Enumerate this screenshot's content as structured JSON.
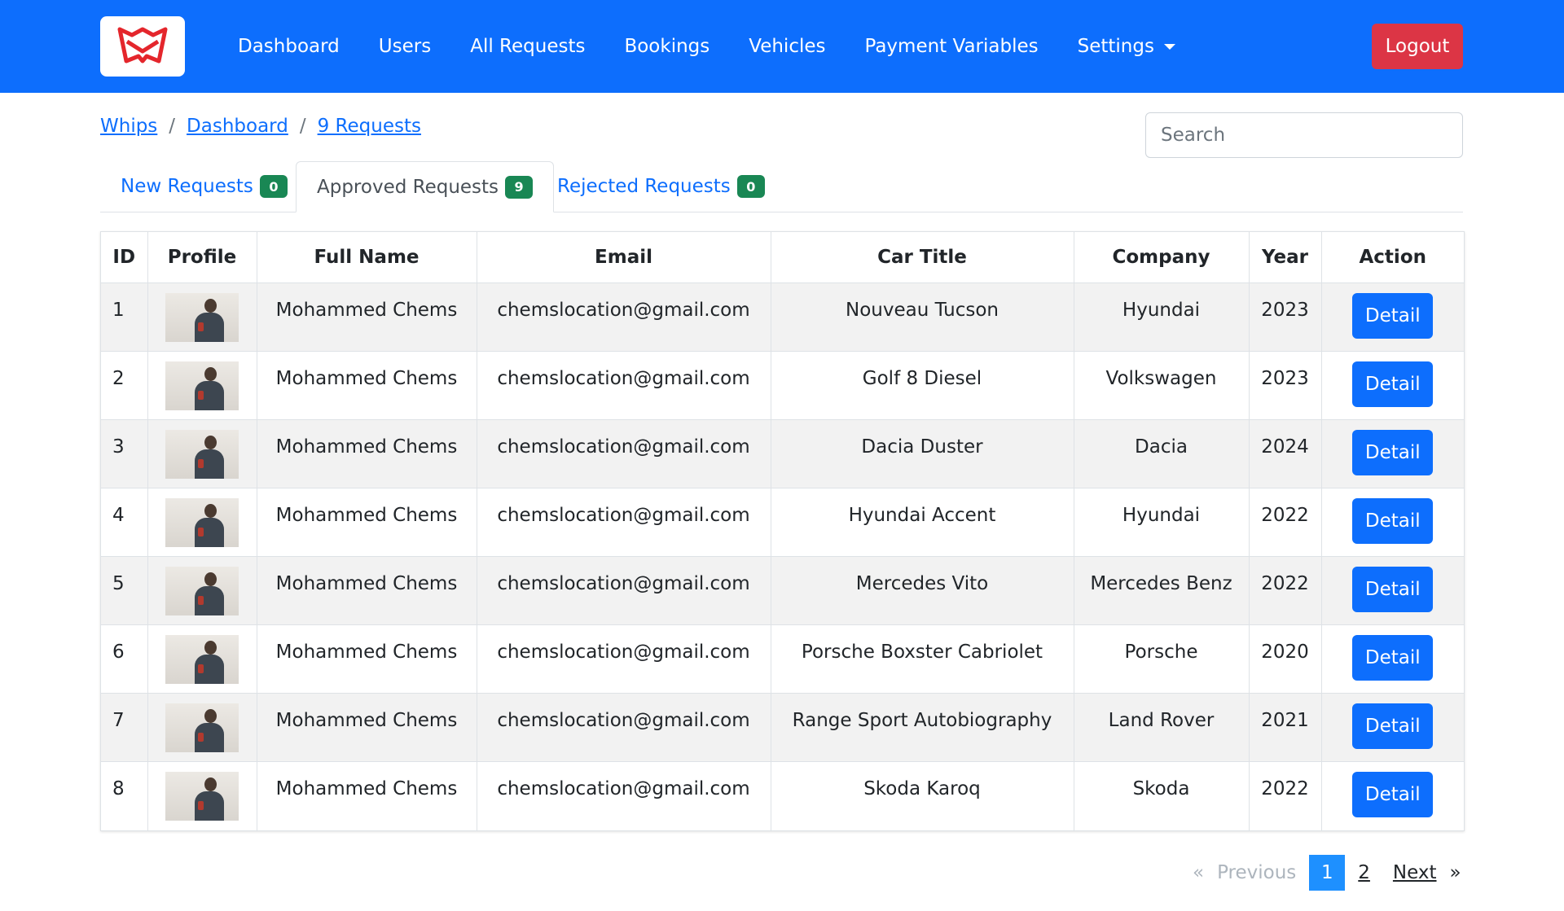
{
  "nav": {
    "items": [
      "Dashboard",
      "Users",
      "All Requests",
      "Bookings",
      "Vehicles",
      "Payment Variables",
      "Settings"
    ],
    "logout_label": "Logout"
  },
  "breadcrumb": {
    "items": [
      "Whips",
      "Dashboard",
      "9 Requests"
    ]
  },
  "search": {
    "placeholder": "Search",
    "value": ""
  },
  "tabs": [
    {
      "label": "New Requests",
      "count": "0"
    },
    {
      "label": "Approved Requests",
      "count": "9",
      "active": true
    },
    {
      "label": "Rejected Requests",
      "count": "0"
    }
  ],
  "table": {
    "columns": [
      "ID",
      "Profile",
      "Full Name",
      "Email",
      "Car Title",
      "Company",
      "Year",
      "Action"
    ],
    "rows": [
      {
        "id": "1",
        "name": "Mohammed Chems",
        "email": "chemslocation@gmail.com",
        "car": "Nouveau Tucson",
        "company": "Hyundai",
        "year": "2023",
        "action": "Detail"
      },
      {
        "id": "2",
        "name": "Mohammed Chems",
        "email": "chemslocation@gmail.com",
        "car": "Golf 8 Diesel",
        "company": "Volkswagen",
        "year": "2023",
        "action": "Detail"
      },
      {
        "id": "3",
        "name": "Mohammed Chems",
        "email": "chemslocation@gmail.com",
        "car": "Dacia Duster",
        "company": "Dacia",
        "year": "2024",
        "action": "Detail"
      },
      {
        "id": "4",
        "name": "Mohammed Chems",
        "email": "chemslocation@gmail.com",
        "car": "Hyundai Accent",
        "company": "Hyundai",
        "year": "2022",
        "action": "Detail"
      },
      {
        "id": "5",
        "name": "Mohammed Chems",
        "email": "chemslocation@gmail.com",
        "car": "Mercedes Vito",
        "company": "Mercedes Benz",
        "year": "2022",
        "action": "Detail"
      },
      {
        "id": "6",
        "name": "Mohammed Chems",
        "email": "chemslocation@gmail.com",
        "car": "Porsche Boxster Cabriolet",
        "company": "Porsche",
        "year": "2020",
        "action": "Detail"
      },
      {
        "id": "7",
        "name": "Mohammed Chems",
        "email": "chemslocation@gmail.com",
        "car": "Range Sport Autobiography",
        "company": "Land Rover",
        "year": "2021",
        "action": "Detail"
      },
      {
        "id": "8",
        "name": "Mohammed Chems",
        "email": "chemslocation@gmail.com",
        "car": "Skoda Karoq",
        "company": "Skoda",
        "year": "2022",
        "action": "Detail"
      }
    ]
  },
  "pagination": {
    "prev_symbol": "«",
    "prev_label": "Previous",
    "pages": [
      "1",
      "2"
    ],
    "current": "1",
    "next_label": "Next",
    "next_symbol": "»"
  },
  "colors": {
    "primary": "#0d6efd",
    "danger": "#dc3545",
    "badge": "#198754",
    "page_active": "#1e90ff"
  },
  "icons": {
    "brand": "whips-logo",
    "avatar": "user-photo",
    "settings": "chevron-down-icon"
  }
}
